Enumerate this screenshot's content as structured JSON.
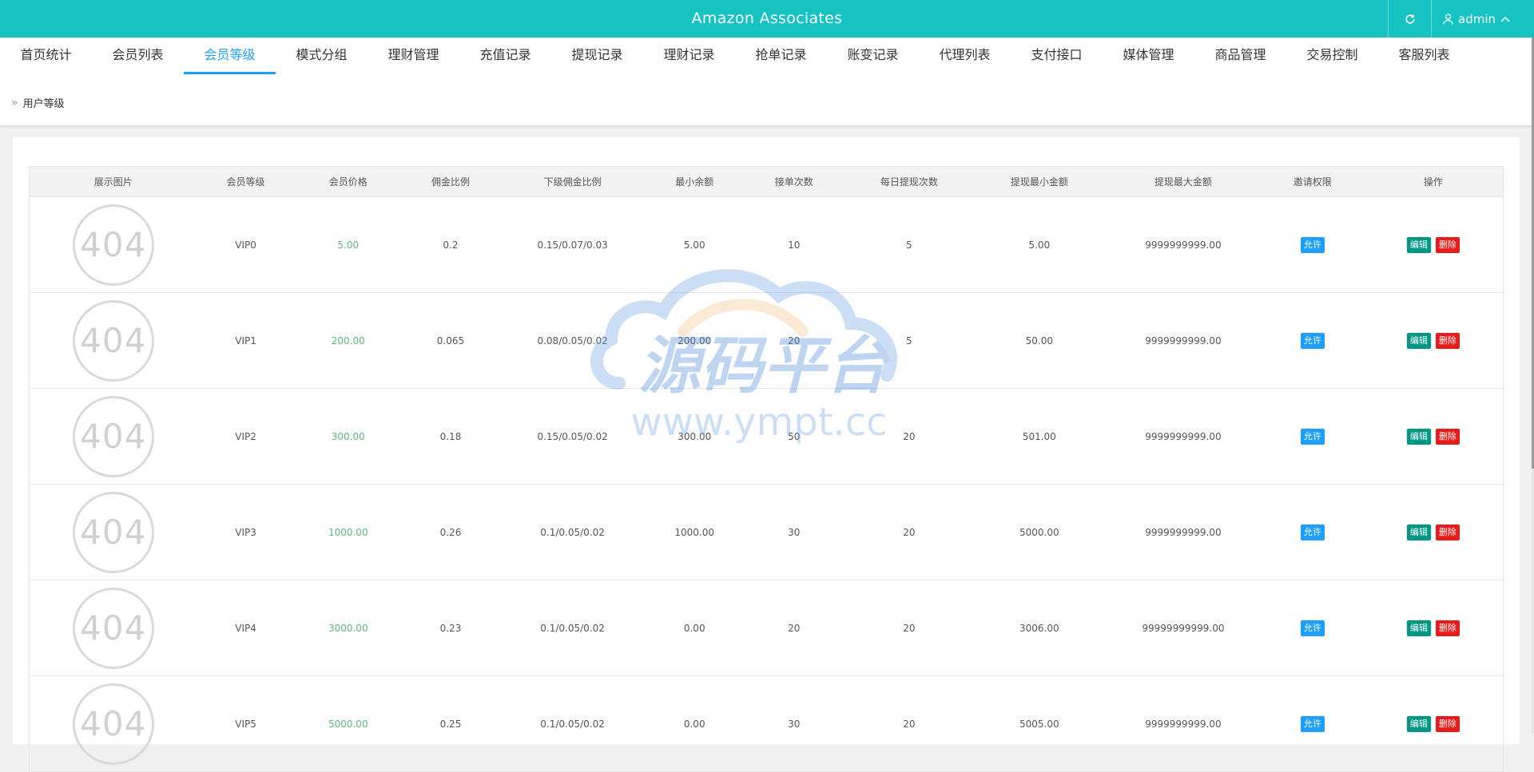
{
  "header": {
    "title": "Amazon Associates",
    "user": "admin",
    "refresh_icon": "refresh-icon",
    "user_icon": "user-icon",
    "chevron_icon": "chevron-up-icon"
  },
  "nav": {
    "tabs": [
      {
        "label": "首页统计"
      },
      {
        "label": "会员列表"
      },
      {
        "label": "会员等级",
        "active": true
      },
      {
        "label": "模式分组"
      },
      {
        "label": "理财管理"
      },
      {
        "label": "充值记录"
      },
      {
        "label": "提现记录"
      },
      {
        "label": "理财记录"
      },
      {
        "label": "抢单记录"
      },
      {
        "label": "账变记录"
      },
      {
        "label": "代理列表"
      },
      {
        "label": "支付接口"
      },
      {
        "label": "媒体管理"
      },
      {
        "label": "商品管理"
      },
      {
        "label": "交易控制"
      },
      {
        "label": "客服列表"
      }
    ]
  },
  "breadcrumb": {
    "current": "用户等级"
  },
  "table": {
    "columns": [
      "展示图片",
      "会员等级",
      "会员价格",
      "佣金比例",
      "下级佣金比例",
      "最小余额",
      "接单次数",
      "每日提现次数",
      "提现最小金额",
      "提现最大金额",
      "邀请权限",
      "操作"
    ],
    "image_placeholder": "404",
    "permission_label": "允许",
    "edit_label": "编辑",
    "delete_label": "删除",
    "rows": [
      {
        "level": "VIP0",
        "price": "5.00",
        "commission": "0.2",
        "sub_commission": "0.15/0.07/0.03",
        "min_balance": "5.00",
        "orders": "10",
        "daily_withdrawals": "5",
        "withdraw_min": "5.00",
        "withdraw_max": "9999999999.00"
      },
      {
        "level": "VIP1",
        "price": "200.00",
        "commission": "0.065",
        "sub_commission": "0.08/0.05/0.02",
        "min_balance": "200.00",
        "orders": "20",
        "daily_withdrawals": "5",
        "withdraw_min": "50.00",
        "withdraw_max": "9999999999.00"
      },
      {
        "level": "VIP2",
        "price": "300.00",
        "commission": "0.18",
        "sub_commission": "0.15/0.05/0.02",
        "min_balance": "300.00",
        "orders": "50",
        "daily_withdrawals": "20",
        "withdraw_min": "501.00",
        "withdraw_max": "9999999999.00"
      },
      {
        "level": "VIP3",
        "price": "1000.00",
        "commission": "0.26",
        "sub_commission": "0.1/0.05/0.02",
        "min_balance": "1000.00",
        "orders": "30",
        "daily_withdrawals": "20",
        "withdraw_min": "5000.00",
        "withdraw_max": "9999999999.00"
      },
      {
        "level": "VIP4",
        "price": "3000.00",
        "commission": "0.23",
        "sub_commission": "0.1/0.05/0.02",
        "min_balance": "0.00",
        "orders": "20",
        "daily_withdrawals": "20",
        "withdraw_min": "3006.00",
        "withdraw_max": "99999999999.00"
      },
      {
        "level": "VIP5",
        "price": "5000.00",
        "commission": "0.25",
        "sub_commission": "0.1/0.05/0.02",
        "min_balance": "0.00",
        "orders": "30",
        "daily_withdrawals": "20",
        "withdraw_min": "5005.00",
        "withdraw_max": "9999999999.00"
      }
    ]
  },
  "watermark": {
    "logo": "源码平台",
    "url": "www.ympt.cc"
  },
  "colors": {
    "header_bg": "#16c3c3",
    "active_tab": "#1e9fff",
    "price_text": "#5fb878",
    "allow_btn": "#1e9fff",
    "edit_btn": "#009688",
    "delete_btn": "#e81b1b"
  }
}
